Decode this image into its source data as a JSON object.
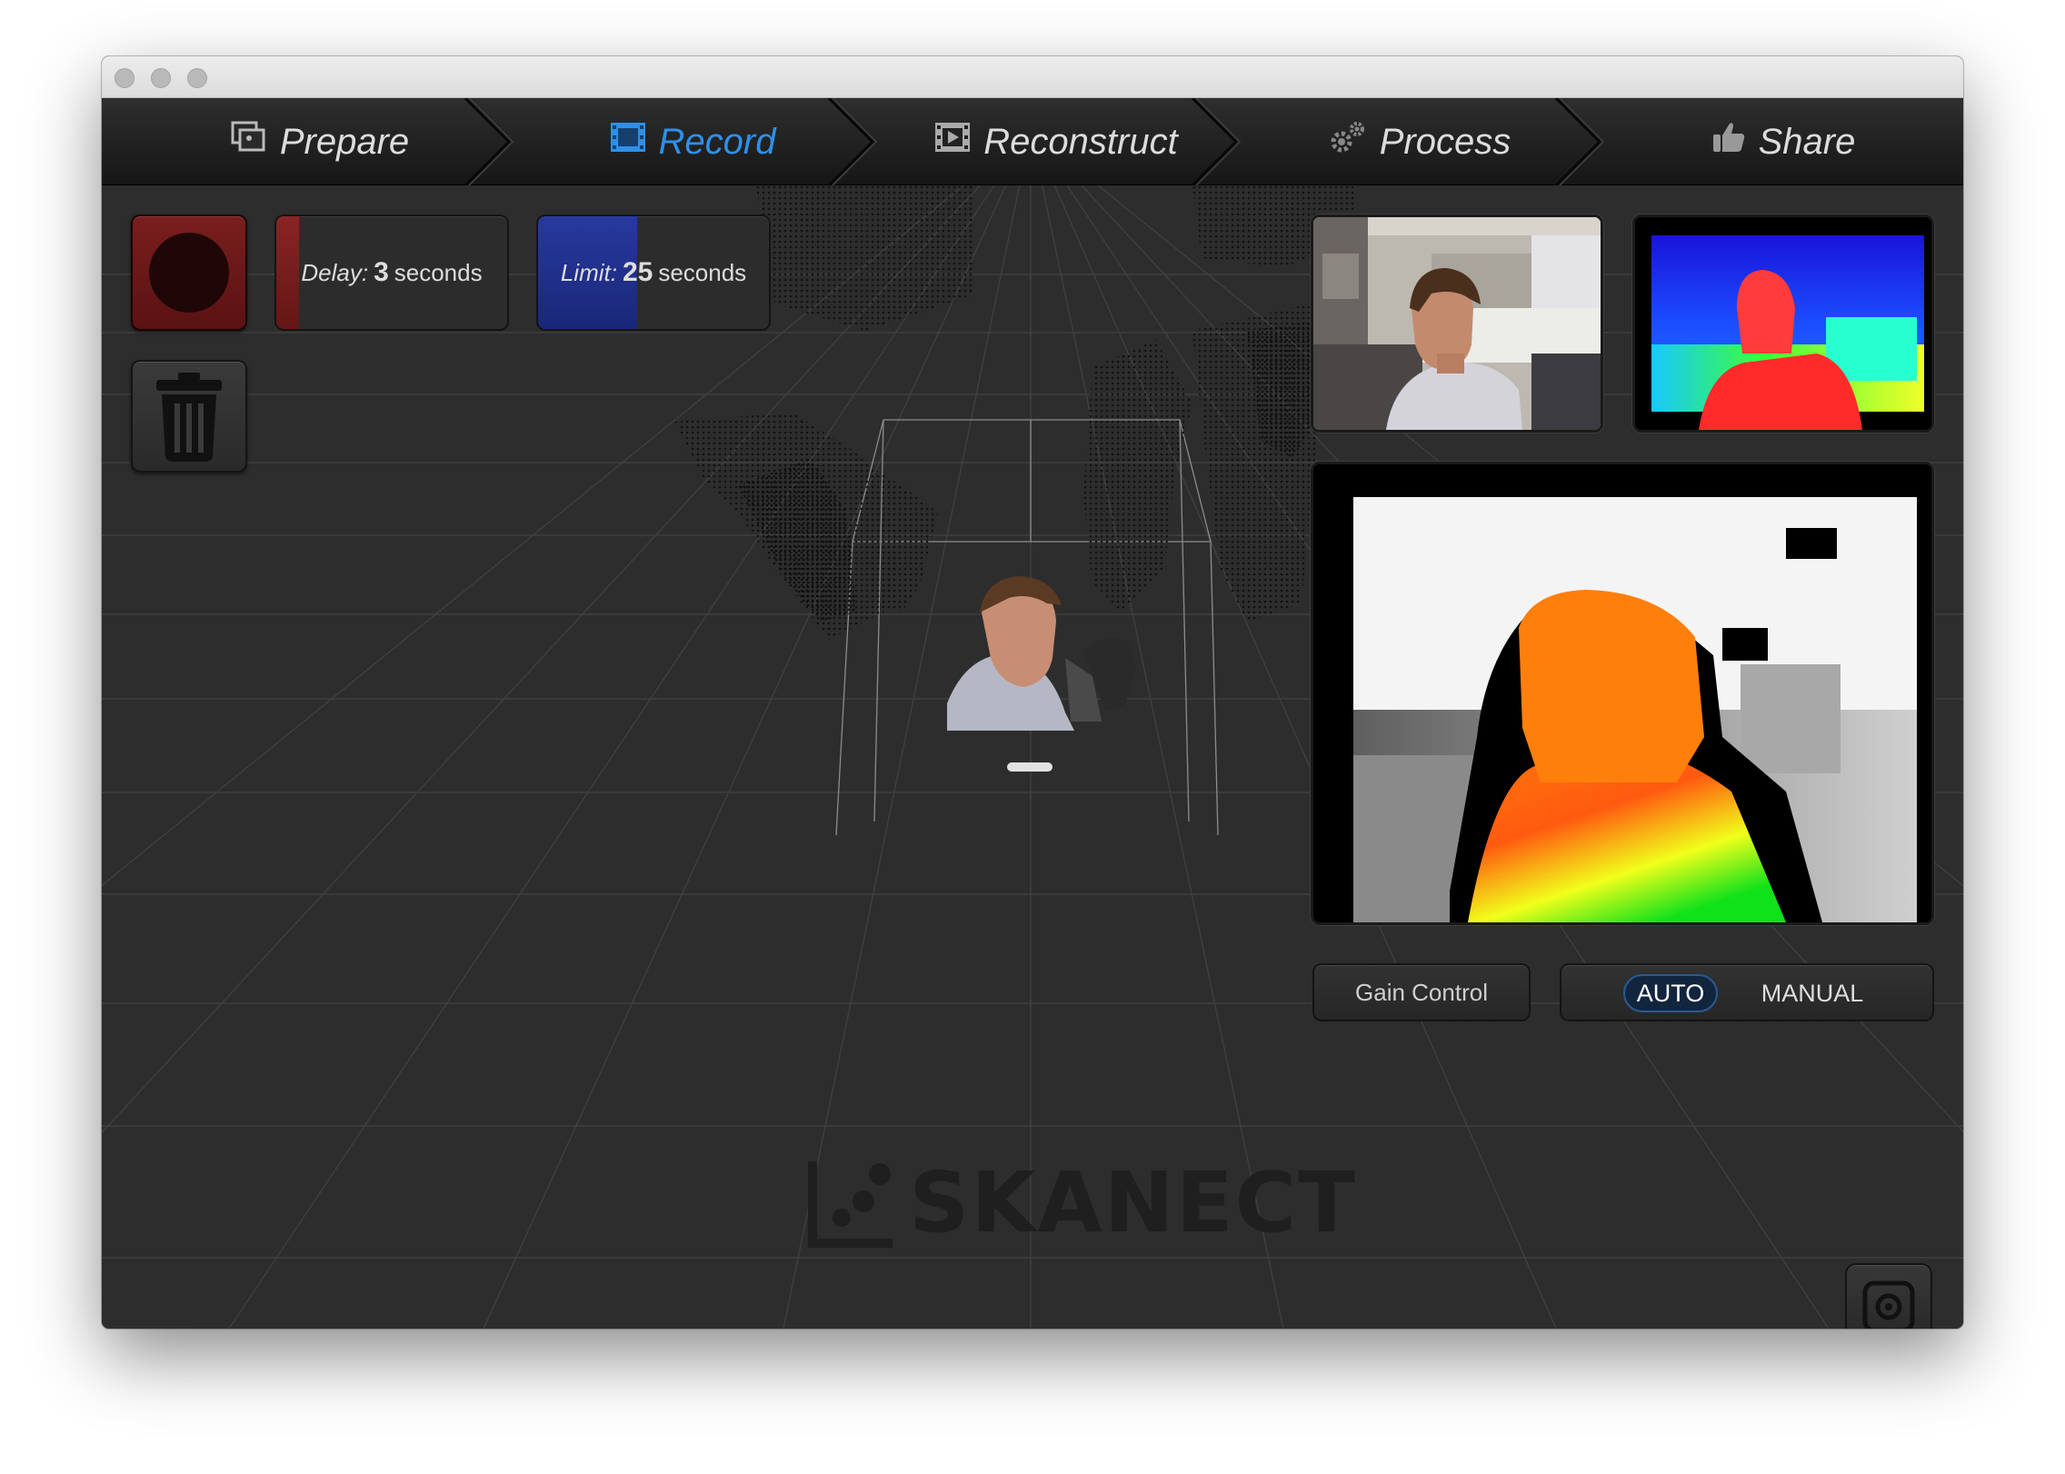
{
  "window": {
    "tabs": [
      {
        "label": "Prepare",
        "icon": "photos-icon",
        "active": false
      },
      {
        "label": "Record",
        "icon": "film-frame-icon",
        "active": true
      },
      {
        "label": "Reconstruct",
        "icon": "film-strip-icon",
        "active": false
      },
      {
        "label": "Process",
        "icon": "gears-icon",
        "active": false
      },
      {
        "label": "Share",
        "icon": "thumbs-up-icon",
        "active": false
      }
    ]
  },
  "controls": {
    "record_button": {
      "icon": "record-circle-icon",
      "color": "#6b1818"
    },
    "trash_button": {
      "icon": "trash-icon"
    },
    "delay": {
      "label": "Delay:",
      "value": "3",
      "unit": "seconds",
      "fill_fraction": 0.1,
      "fill_color": "#7a1e1e"
    },
    "limit": {
      "label": "Limit:",
      "value": "25",
      "unit": "seconds",
      "fill_fraction": 0.43,
      "fill_color": "#1e2f8a"
    }
  },
  "camera": {
    "gain_control_label": "Gain Control",
    "gain_modes": {
      "auto": "AUTO",
      "manual": "MANUAL",
      "selected": "AUTO"
    },
    "snapshot_button": {
      "icon": "camera-snapshot-icon"
    }
  },
  "branding": {
    "logo_text": "SKANECT"
  },
  "colors": {
    "accent": "#2f8fe8",
    "background": "#2d2d2d",
    "record_red": "#6b1818",
    "limit_blue": "#1e2f8a"
  }
}
